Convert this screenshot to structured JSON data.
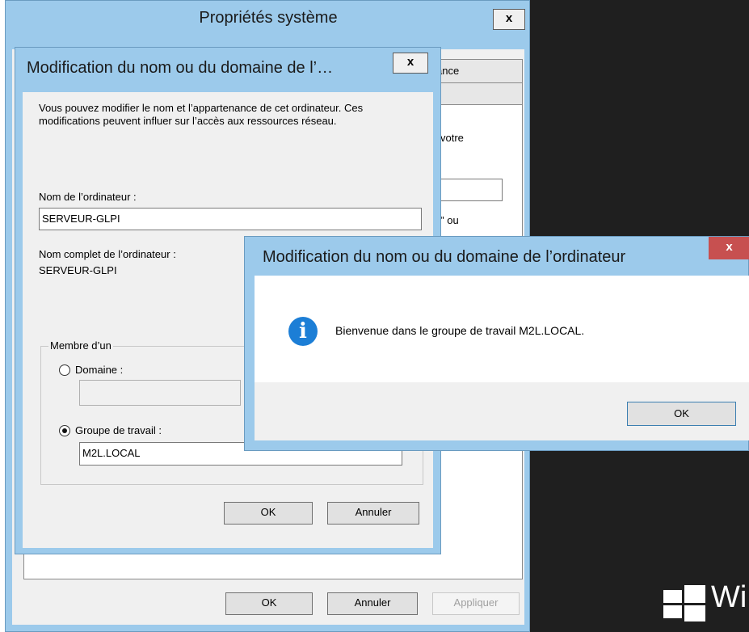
{
  "sysprops": {
    "title": "Propriétés système",
    "close_label": "x",
    "tab_partial": "ance",
    "partial_text_1": "votre",
    "partial_text_2": "\" ou",
    "buttons": {
      "ok": "OK",
      "cancel": "Annuler",
      "apply": "Appliquer"
    }
  },
  "name_dialog": {
    "title": "Modification du nom ou du domaine de l’…",
    "close_label": "x",
    "description": "Vous pouvez modifier le nom et l’appartenance de cet ordinateur. Ces modifications peuvent influer sur l’accès aux ressources réseau.",
    "computer_name_label": "Nom de l’ordinateur :",
    "computer_name_value": "SERVEUR-GLPI",
    "full_name_label": "Nom complet de l’ordinateur :",
    "full_name_value": "SERVEUR-GLPI",
    "member_of": {
      "legend": "Membre d’un",
      "domain_label": "Domaine :",
      "domain_value": "",
      "workgroup_label": "Groupe de travail :",
      "workgroup_value": "M2L.LOCAL",
      "selected": "workgroup"
    },
    "buttons": {
      "ok": "OK",
      "cancel": "Annuler"
    }
  },
  "message_box": {
    "title": "Modification du nom ou du domaine de l’ordinateur",
    "close_label": "x",
    "icon": "info-icon",
    "message": "Bienvenue dans le groupe de travail M2L.LOCAL.",
    "ok_label": "OK"
  },
  "desktop": {
    "brand_partial": "Wi"
  },
  "colors": {
    "title_bar": "#9ccaeb",
    "close_red": "#c75050",
    "info_blue": "#1c7ed6",
    "desktop": "#1f1f1f"
  }
}
